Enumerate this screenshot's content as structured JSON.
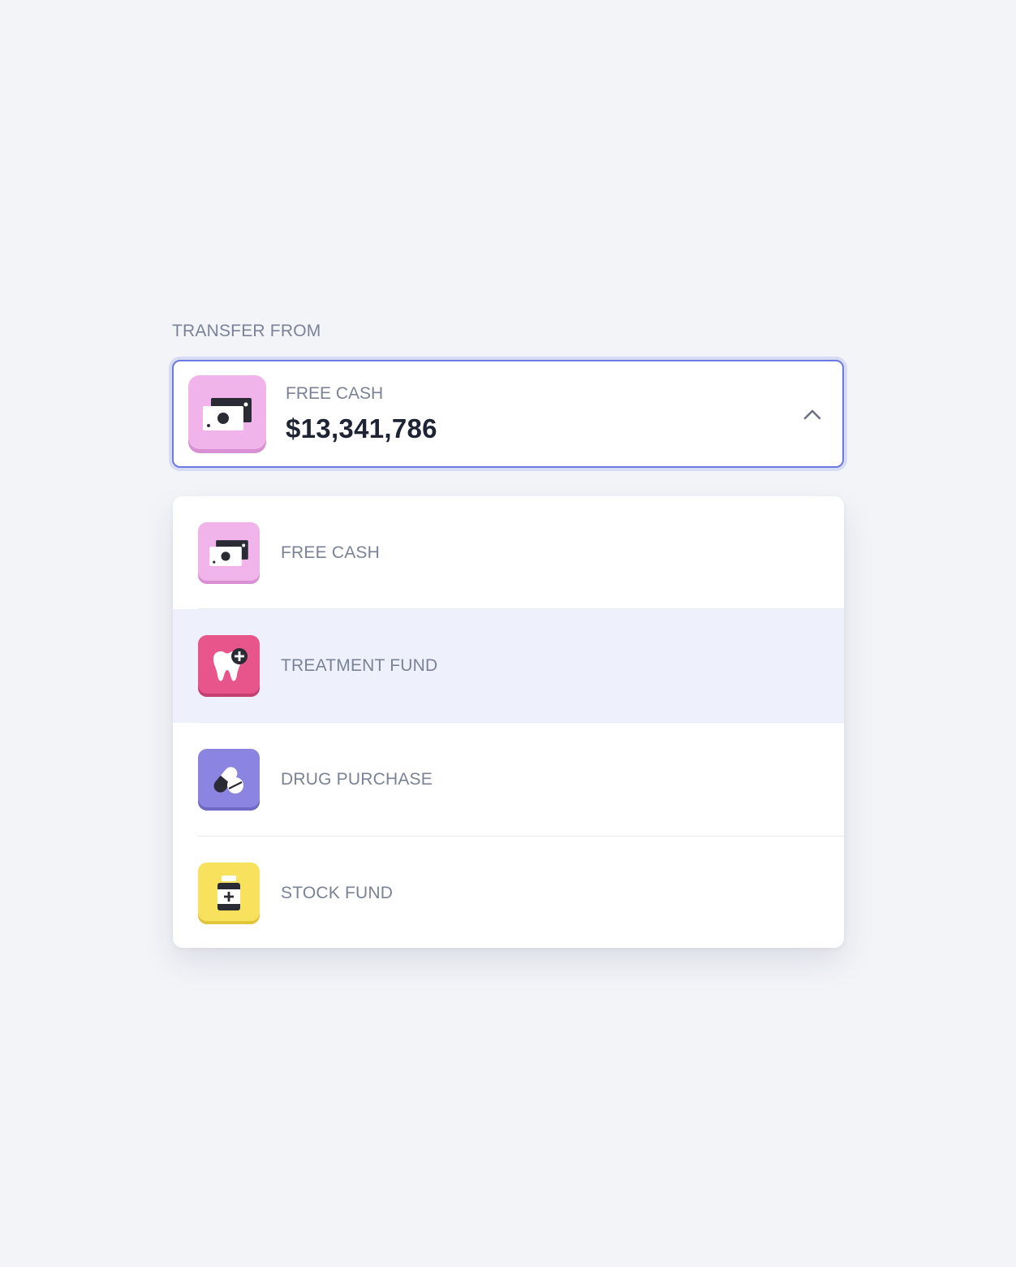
{
  "transfer": {
    "label": "TRANSFER FROM"
  },
  "selected": {
    "title": "FREE CASH",
    "amount": "$13,341,786",
    "icon": "cash-icon",
    "icon_color": "#f0b4eb",
    "icon_shadow": "#d98fd3",
    "expanded": true
  },
  "options": [
    {
      "label": "FREE CASH",
      "icon": "cash-icon",
      "color": "#f0b4eb",
      "shadow": "#d98fd3"
    },
    {
      "label": "TREATMENT FUND",
      "icon": "tooth-icon",
      "color": "#e8558a",
      "shadow": "#c53f71",
      "highlighted": true
    },
    {
      "label": "DRUG PURCHASE",
      "icon": "pill-icon",
      "color": "#8b84e0",
      "shadow": "#6f68c4"
    },
    {
      "label": "STOCK FUND",
      "icon": "medicine-bottle-icon",
      "color": "#f8e15c",
      "shadow": "#e1c53c"
    }
  ],
  "colors": {
    "background": "#f2f4f8",
    "focus_border": "#6b7ae0",
    "text_muted": "#7b8296",
    "text_dark": "#1e2433",
    "highlight_row": "#eef1fc"
  }
}
